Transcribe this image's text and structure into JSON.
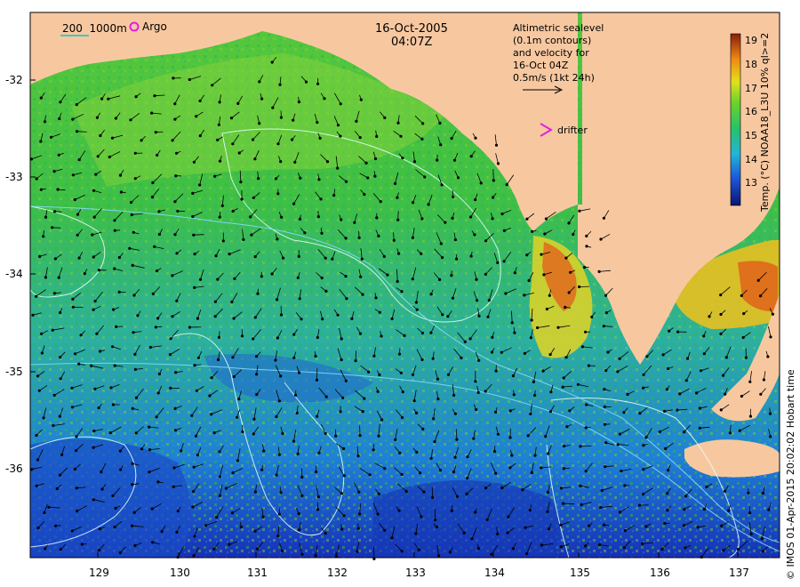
{
  "map": {
    "date": "16-Oct-2005",
    "time": "04:07Z",
    "altimetry_note": [
      "Altimetric sealevel",
      "(0.1m contours)",
      "and velocity for",
      "16-Oct 04Z",
      "0.5m/s (1kt 24h)"
    ],
    "drifter_label": "drifter",
    "isobaths_label": "200  1000m",
    "argo_label": "Argo",
    "colorbar": {
      "title": "Temp. (°C) NOAA18_L3U 10% ql>=2",
      "ticks": [
        "19",
        "18",
        "17",
        "16",
        "15",
        "14",
        "13"
      ]
    },
    "lat_ticks": [
      "-32",
      "-33",
      "-34",
      "-35",
      "-36"
    ],
    "lon_ticks": [
      "129",
      "130",
      "131",
      "132",
      "133",
      "134",
      "135",
      "136",
      "137"
    ],
    "credit": "© IMOS 01-Apr-2015 20:02:02 Hobart time",
    "colors": {
      "land": "#f7c8a0",
      "warm": "#e05a1a",
      "mid": "#3cc83c",
      "cool": "#1f8ad8",
      "cold": "#0a1aa8"
    }
  }
}
